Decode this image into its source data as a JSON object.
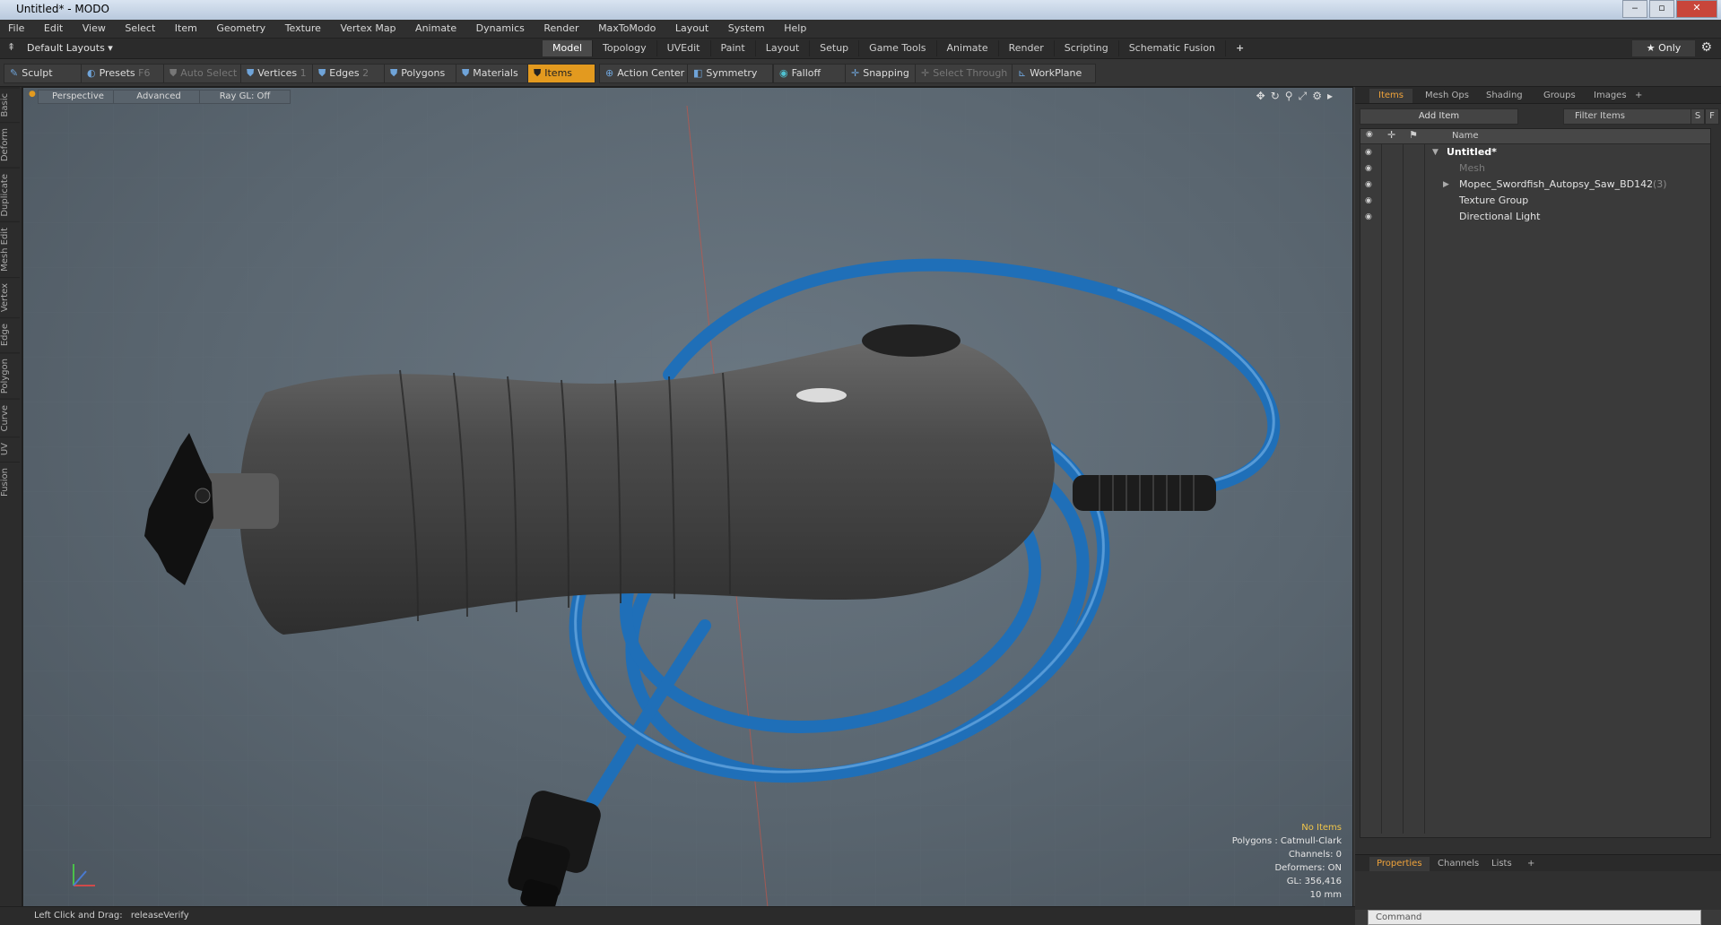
{
  "window": {
    "title": "Untitled* - MODO",
    "min": "‒",
    "max": "▫",
    "close": "✕"
  },
  "menu": [
    "File",
    "Edit",
    "View",
    "Select",
    "Item",
    "Geometry",
    "Texture",
    "Vertex Map",
    "Animate",
    "Dynamics",
    "Render",
    "MaxToModo",
    "Layout",
    "System",
    "Help"
  ],
  "layout": {
    "name": "Default Layouts ▾",
    "only_label": "★ Only"
  },
  "tabs": [
    "Model",
    "Topology",
    "UVEdit",
    "Paint",
    "Layout",
    "Setup",
    "Game Tools",
    "Animate",
    "Render",
    "Scripting",
    "Schematic Fusion",
    "+"
  ],
  "toolbar": {
    "sculpt": "Sculpt",
    "presets": "Presets",
    "presets_key": "F6",
    "auto_select": "Auto Select",
    "vertices": "Vertices",
    "vertices_key": "1",
    "edges": "Edges",
    "edges_key": "2",
    "polygons": "Polygons",
    "materials": "Materials",
    "items": "Items",
    "action_center": "Action Center",
    "symmetry": "Symmetry",
    "falloff": "Falloff",
    "snapping": "Snapping",
    "select_through": "Select Through",
    "workplane": "WorkPlane"
  },
  "left_tabs": [
    "Basic",
    "Deform",
    "Duplicate",
    "Mesh Edit",
    "Vertex",
    "Edge",
    "Polygon",
    "Curve",
    "UV",
    "Fusion"
  ],
  "viewport": {
    "perspective": "Perspective",
    "advanced": "Advanced",
    "raygl": "Ray GL: Off",
    "info": {
      "no_items": "No Items",
      "polygons": "Polygons : Catmull-Clark",
      "channels": "Channels: 0",
      "deformers": "Deformers: ON",
      "gl": "GL: 356,416",
      "scale": "10 mm"
    }
  },
  "right_panel": {
    "tabs": [
      "Items",
      "Mesh Ops",
      "Shading",
      "Groups",
      "Images",
      "+"
    ],
    "add_item": "Add Item",
    "filter": "Filter Items",
    "s": "S",
    "f": "F",
    "name_col": "Name",
    "items": [
      {
        "label": "Untitled*",
        "style": "bold",
        "indent": 80
      },
      {
        "label": "Mesh",
        "style": "dim",
        "indent": 104
      },
      {
        "label": "Mopec_Swordfish_Autopsy_Saw_BD142",
        "count": "(3)",
        "style": "",
        "indent": 104
      },
      {
        "label": "Texture Group",
        "style": "",
        "indent": 104
      },
      {
        "label": "Directional Light",
        "style": "",
        "indent": 104
      }
    ],
    "prop_tabs": [
      "Properties",
      "Channels",
      "Lists",
      "+"
    ],
    "command_placeholder": "Command"
  },
  "status": {
    "hint": "Left Click and Drag:",
    "action": "releaseVerify"
  },
  "colors": {
    "accent": "#e39a1f",
    "hose": "#1f6fb8",
    "body": "#4a4a4a"
  }
}
